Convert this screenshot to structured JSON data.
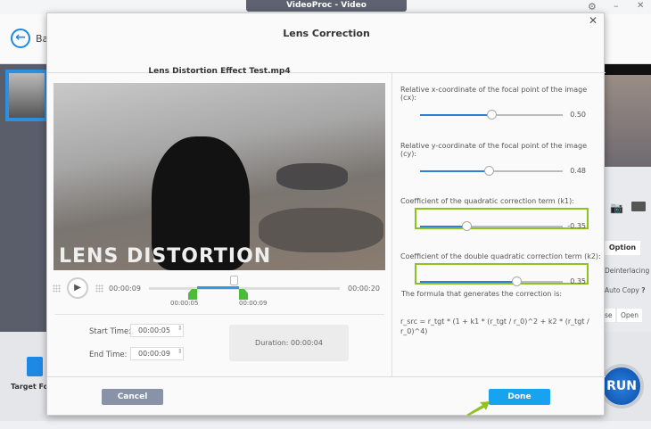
{
  "app": {
    "title": "VideoProc - Video",
    "back_label": "Ba",
    "target_label": "Target For",
    "run_label": "RUN",
    "bg_option": "Option",
    "bg_deinterlacing": "Deinterlacing",
    "bg_autocopy": "Auto Copy",
    "bg_autocopy_help": "?",
    "bg_browse": "se",
    "bg_open": "Open"
  },
  "dialog": {
    "title": "Lens Correction",
    "file_name": "Lens Distortion Effect Test.mp4",
    "video_overlay_text": "LENS DISTORTION",
    "player": {
      "current_time": "00:00:09",
      "total_time": "00:00:20",
      "mark_start": "00:00:05",
      "mark_end": "00:00:09",
      "playhead_fraction": 0.45,
      "start_fraction": 0.25,
      "end_fraction": 0.47
    },
    "start_label": "Start Time:",
    "start_value": "00:00:05",
    "end_label": "End Time:",
    "end_value": "00:00:09",
    "duration": "Duration: 00:00:04",
    "params": [
      {
        "label": "Relative x-coordinate of the focal point of the image (cx):",
        "value": "0.50",
        "fraction": 0.5,
        "highlight": false
      },
      {
        "label": "Relative y-coordinate of the focal point of the image (cy):",
        "value": "0.48",
        "fraction": 0.48,
        "highlight": false
      },
      {
        "label": "Coefficient of the quadratic correction term (k1):",
        "value": "-0.35",
        "fraction": 0.325,
        "highlight": true
      },
      {
        "label": "Coefficient of the double quadratic correction term (k2):",
        "value": "0.35",
        "fraction": 0.675,
        "highlight": true
      }
    ],
    "formula_label": "The formula that generates the correction is:",
    "formula": "r_src = r_tgt * (1 + k1 * (r_tgt / r_0)^2 + k2 * (r_tgt / r_0)^4)",
    "cancel_label": "Cancel",
    "done_label": "Done",
    "highlight_color": "#8dc21f"
  }
}
